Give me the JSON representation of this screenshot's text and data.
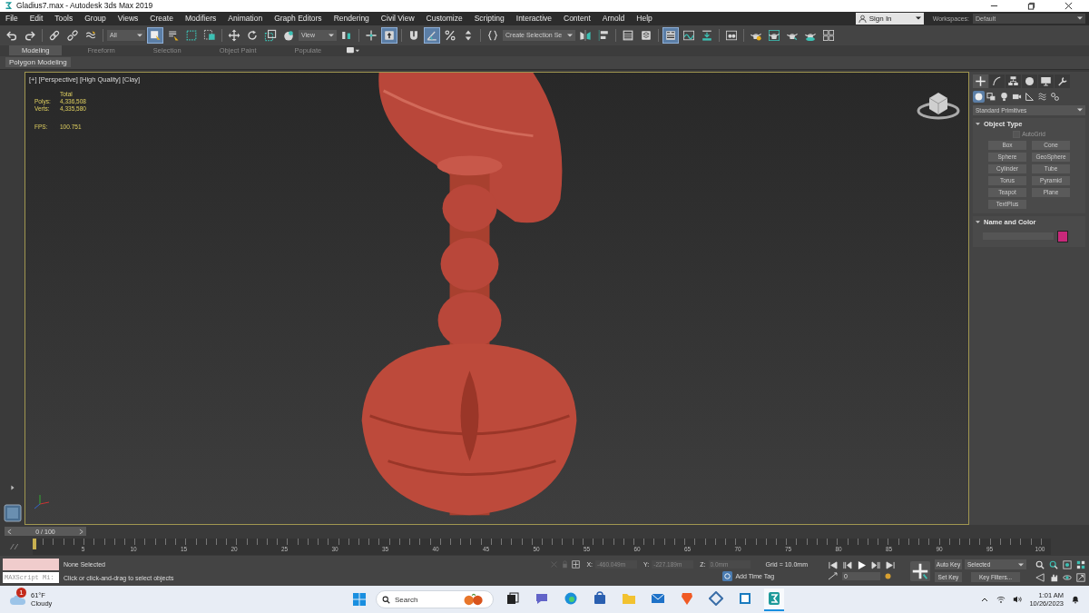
{
  "window": {
    "title": "Gladius7.max - Autodesk 3ds Max 2019"
  },
  "menu": [
    "File",
    "Edit",
    "Tools",
    "Group",
    "Views",
    "Create",
    "Modifiers",
    "Animation",
    "Graph Editors",
    "Rendering",
    "Civil View",
    "Customize",
    "Scripting",
    "Interactive",
    "Content",
    "Arnold",
    "Help"
  ],
  "account": {
    "label": "Sign In"
  },
  "workspaces": {
    "label": "Workspaces:",
    "value": "Default"
  },
  "toolbar": [
    {
      "kind": "undo",
      "selected": false
    },
    {
      "kind": "redo",
      "selected": false
    },
    {
      "kind": "sep"
    },
    {
      "kind": "link",
      "selected": false
    },
    {
      "kind": "unlink",
      "selected": false
    },
    {
      "kind": "bind",
      "selected": false
    },
    {
      "kind": "sep"
    },
    {
      "kind": "dropdown",
      "value": "All"
    },
    {
      "kind": "select",
      "selected": true
    },
    {
      "kind": "select_name",
      "selected": false
    },
    {
      "kind": "region",
      "selected": false
    },
    {
      "kind": "crossing",
      "selected": false
    },
    {
      "kind": "sep"
    },
    {
      "kind": "move",
      "selected": false
    },
    {
      "kind": "rotate",
      "selected": false
    },
    {
      "kind": "scale",
      "selected": false
    },
    {
      "kind": "place",
      "selected": false
    },
    {
      "kind": "dropdown",
      "value": "View"
    },
    {
      "kind": "pivot",
      "selected": false
    },
    {
      "kind": "sep"
    },
    {
      "kind": "manipulate",
      "selected": false
    },
    {
      "kind": "keyboard",
      "selected": true
    },
    {
      "kind": "sep"
    },
    {
      "kind": "snap",
      "selected": false
    },
    {
      "kind": "angle",
      "selected": true
    },
    {
      "kind": "percent",
      "selected": false
    },
    {
      "kind": "spinner",
      "selected": false
    },
    {
      "kind": "sep"
    },
    {
      "kind": "named",
      "selected": false
    },
    {
      "kind": "dropdown",
      "value": "Create Selection Se"
    },
    {
      "kind": "mirror",
      "selected": false
    },
    {
      "kind": "align",
      "selected": false
    },
    {
      "kind": "sep"
    },
    {
      "kind": "explorer",
      "selected": false
    },
    {
      "kind": "layer",
      "selected": false
    },
    {
      "kind": "sep"
    },
    {
      "kind": "ribbon",
      "selected": true
    },
    {
      "kind": "curve",
      "selected": false
    },
    {
      "kind": "schematic",
      "selected": false
    },
    {
      "kind": "sep"
    },
    {
      "kind": "material",
      "selected": false
    },
    {
      "kind": "sep"
    },
    {
      "kind": "render_setup",
      "selected": false
    },
    {
      "kind": "rendered_frame",
      "selected": false
    },
    {
      "kind": "render",
      "selected": false
    },
    {
      "kind": "render_cloud",
      "selected": false
    },
    {
      "kind": "arnold",
      "selected": false
    }
  ],
  "ribbon": {
    "tabs": [
      {
        "label": "Modeling",
        "selected": true
      },
      {
        "label": "Freeform",
        "selected": false
      },
      {
        "label": "Selection",
        "selected": false
      },
      {
        "label": "Object Paint",
        "selected": false
      },
      {
        "label": "Populate",
        "selected": false
      }
    ],
    "panel": "Polygon Modeling"
  },
  "viewport": {
    "labels": [
      "[+]",
      "[Perspective]",
      "[High Quality]",
      "[Clay]"
    ],
    "stats_header": "Total",
    "stats": [
      {
        "label": "Polys:",
        "value": "4,336,508"
      },
      {
        "label": "Verts:",
        "value": "4,335,580"
      }
    ],
    "fps": {
      "label": "FPS:",
      "value": "100.751"
    }
  },
  "command_panel": {
    "tabs": [
      {
        "kind": "create",
        "selected": true
      },
      {
        "kind": "modify",
        "selected": false
      },
      {
        "kind": "hierarchy",
        "selected": false
      },
      {
        "kind": "motion",
        "selected": false
      },
      {
        "kind": "display",
        "selected": false
      },
      {
        "kind": "utilities",
        "selected": false
      }
    ],
    "categories": [
      {
        "kind": "geometry",
        "selected": true
      },
      {
        "kind": "shapes",
        "selected": false
      },
      {
        "kind": "lights",
        "selected": false
      },
      {
        "kind": "cameras",
        "selected": false
      },
      {
        "kind": "helpers",
        "selected": false
      },
      {
        "kind": "spacewarps",
        "selected": false
      },
      {
        "kind": "systems",
        "selected": false
      }
    ],
    "dropdown": "Standard Primitives",
    "object_type": {
      "title": "Object Type",
      "autogrid": {
        "label": "AutoGrid",
        "checked": false,
        "disabled": true
      },
      "buttons": [
        "Box",
        "Cone",
        "Sphere",
        "GeoSphere",
        "Cylinder",
        "Tube",
        "Torus",
        "Pyramid",
        "Teapot",
        "Plane",
        "TextPlus"
      ]
    },
    "name_and_color": {
      "title": "Name and Color",
      "color": "#c8287a"
    }
  },
  "time_slider": {
    "label": "0 / 100",
    "level": 0
  },
  "timeline": {
    "ticks": [
      "5",
      "10",
      "15",
      "20",
      "25",
      "30",
      "35",
      "40",
      "45",
      "50",
      "55",
      "60",
      "65",
      "70",
      "75",
      "80",
      "85",
      "90",
      "95",
      "100"
    ]
  },
  "status": {
    "maxscript": "MAXScript Mi:",
    "selection": "None Selected",
    "prompt": "Click or click-and-drag to select objects",
    "coords": [
      {
        "axis": "X:",
        "value": "-460.049m",
        "disabled": true
      },
      {
        "axis": "Y:",
        "value": "-227.189m",
        "disabled": true
      },
      {
        "axis": "Z:",
        "value": "0.0mm",
        "disabled": true
      }
    ],
    "grid": "Grid = 10.0mm",
    "time_tag": "Add Time Tag",
    "frame": "0",
    "auto_key": "Auto Key",
    "set_key": "Set Key",
    "key_mode": "Selected",
    "key_filters": "Key Filters..."
  },
  "taskbar": {
    "weather": {
      "temp": "61°F",
      "condition": "Cloudy",
      "badge": "1"
    },
    "search": {
      "placeholder": "Search"
    },
    "apps": [
      {
        "kind": "taskview",
        "selected": false
      },
      {
        "kind": "chat",
        "selected": false
      },
      {
        "kind": "edge",
        "selected": false
      },
      {
        "kind": "store",
        "selected": false
      },
      {
        "kind": "folder",
        "selected": false
      },
      {
        "kind": "mail",
        "selected": false
      },
      {
        "kind": "brave",
        "selected": false
      },
      {
        "kind": "snip",
        "selected": false
      },
      {
        "kind": "window",
        "selected": false
      },
      {
        "kind": "max",
        "selected": true
      }
    ],
    "time": "1:01 AM",
    "date": "10/26/2023"
  }
}
